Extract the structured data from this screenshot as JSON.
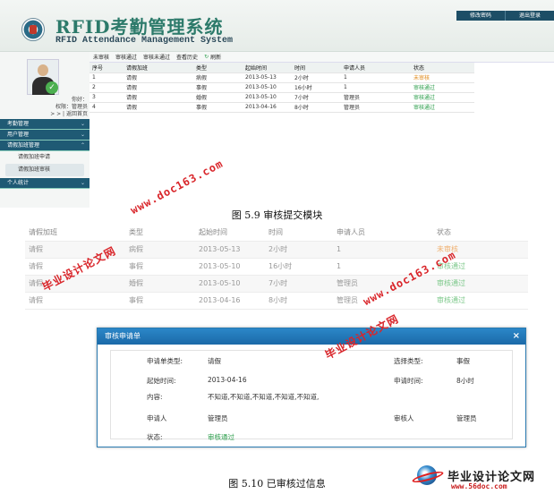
{
  "fig1": {
    "brand_title": "RFID考勤管理系统",
    "brand_subtitle": "RFID Attendance Management System",
    "topbar": {
      "change_password": "修改密码",
      "logout": "退出登录"
    },
    "user_info": {
      "line1": "你好：",
      "line2": "权限：管理员",
      "line3": "> > | 返回首页"
    },
    "menu": [
      {
        "label": "考勤管理",
        "type": "header"
      },
      {
        "label": "用户管理",
        "type": "header"
      },
      {
        "label": "请假加班管理",
        "type": "header"
      },
      {
        "label": "请假加班申请",
        "type": "item"
      },
      {
        "label": "请假加班审核",
        "type": "item-active"
      },
      {
        "label": "个人统计",
        "type": "header"
      }
    ],
    "toolbar": [
      "未审核",
      "审核通过",
      "审核未通过",
      "查看历史"
    ],
    "refresh_label": "刷新",
    "table": {
      "headers": [
        "序号",
        "请假加班",
        "类型",
        "起始时间",
        "时间",
        "申请人员",
        "状态"
      ],
      "rows": [
        [
          "1",
          "请假",
          "病假",
          "2013-05-13",
          "2小时",
          "1",
          "未审核"
        ],
        [
          "2",
          "请假",
          "事假",
          "2013-05-10",
          "16小时",
          "1",
          "审核通过"
        ],
        [
          "3",
          "请假",
          "婚假",
          "2013-05-10",
          "7小时",
          "管理员",
          "审核通过"
        ],
        [
          "4",
          "请假",
          "事假",
          "2013-04-16",
          "8小时",
          "管理员",
          "审核通过"
        ]
      ]
    },
    "caption": "图 5.9  审核提交模块"
  },
  "fig2": {
    "table": {
      "headers": [
        "请假加班",
        "类型",
        "起始时间",
        "时间",
        "申请人员",
        "状态"
      ],
      "rows": [
        [
          "请假",
          "病假",
          "2013-05-13",
          "2小时",
          "1",
          "未审核"
        ],
        [
          "请假",
          "事假",
          "2013-05-10",
          "16小时",
          "1",
          "审核通过"
        ],
        [
          "请假",
          "婚假",
          "2013-05-10",
          "7小时",
          "管理员",
          "审核通过"
        ],
        [
          "请假",
          "事假",
          "2013-04-16",
          "8小时",
          "管理员",
          "审核通过"
        ]
      ]
    },
    "modal": {
      "title": "审核申请单",
      "close": "×",
      "req_type_label": "申请单类型:",
      "req_type_value": "请假",
      "select_type_label": "选择类型:",
      "select_type_value": "事假",
      "start_label": "起始时间:",
      "start_value": "2013-04-16",
      "apply_time_label": "申请时间:",
      "apply_time_value": "8小时",
      "content_label": "内容:",
      "content_value": "不知道,不知道,不知道,不知道,不知道,",
      "applicant_label": "申请人",
      "applicant_value": "管理员",
      "reviewer_label": "审核人",
      "reviewer_value": "管理员",
      "status_label": "状态:",
      "status_value": "审核通过"
    },
    "caption": "图 5.10  已审核过信息"
  },
  "watermarks": {
    "site": "www.doc163.com",
    "cn": "毕业设计论文网",
    "corner_title": "毕业设计论文网",
    "corner_site": "www.56doc.com"
  },
  "colors": {
    "nav": "#1f5a74",
    "pending": "#e08a1a",
    "pass": "#2a9d4a",
    "watermark": "#d9252a",
    "modal": "#1b69a8"
  }
}
